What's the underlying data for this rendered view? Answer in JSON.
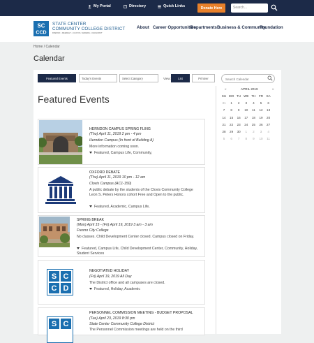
{
  "topbar": {
    "portal": "My Portal",
    "directory": "Directory",
    "quicklinks": "Quick Links",
    "donate": "Donate Here",
    "search_placeholder": "Search..."
  },
  "logo": {
    "line1": "STATE CENTER",
    "line2": "COMMUNITY COLLEGE DISTRICT",
    "line3": "FRESNO • REEDLEY • CLOVIS • MADERA • OAKHURST",
    "mark": "SC CCD"
  },
  "nav": [
    "About",
    "Career Opportunities",
    "Departments",
    "Business & Community",
    "Foundation"
  ],
  "breadcrumb": "Home / Calendar",
  "page_title": "Calendar",
  "toolbar": {
    "featured": "Featured Events",
    "today": "Today's Events",
    "category": "Select Category",
    "view_label": "View:",
    "list": "List",
    "print": "Printver",
    "search_placeholder": "Search Calendar"
  },
  "featured_heading": "Featured Events",
  "events": [
    {
      "title": "HERNDON CAMPUS SPRING FLING",
      "date": "(Thu) April 11, 2019 2 pm - 4 pm",
      "location": "Herndon Campus (In front of Building A)",
      "desc": "More information coming soon.",
      "tags": "Featured, Campus Life, Community,"
    },
    {
      "title": "OXFORD DEBATE",
      "date": "(Thu) April 11, 2019 10 pm - 12 am",
      "location": "Clovis Campus (AC1-150)",
      "desc": "A public debate by the students of the Clovis Community College Leon S. Peters Honors cohort Free and Open to the public.",
      "tags": "Featured, Academic, Campus Life,"
    },
    {
      "title": "SPRING BREAK",
      "date": "(Mon) April 15 - (Fri) April 19, 2019 3 am - 3 am",
      "location": "Fresno City College",
      "desc": "No classes. Child Development Center closed. Campus closed on Friday.",
      "tags": "Featured, Campus Life, Child Development Center, Community, Holiday, Student Services"
    },
    {
      "title": "NEGOTIATED HOLIDAY",
      "date": "(Fri) April 19, 2019 All Day",
      "location": "",
      "desc": "The District office and all campuses are closed.",
      "tags": "Featured, Holiday, Academic"
    },
    {
      "title": "PERSONNEL COMMISSION MEETING - BUDGET PROPOSAL",
      "date": "(Tue) April 23, 2019 8:30 pm",
      "location": "State Center Community College District",
      "desc": "The Personnel Commission meetings are held on the third",
      "tags": ""
    }
  ],
  "calendar": {
    "month": "APRIL 2019",
    "prev": "«",
    "next": "»",
    "days": [
      "SU",
      "MO",
      "TU",
      "WE",
      "TH",
      "FR",
      "SA"
    ],
    "weeks": [
      [
        "31",
        "1",
        "2",
        "3",
        "4",
        "5",
        "6"
      ],
      [
        "7",
        "8",
        "9",
        "10",
        "11",
        "12",
        "13"
      ],
      [
        "14",
        "15",
        "16",
        "17",
        "18",
        "19",
        "20"
      ],
      [
        "21",
        "22",
        "23",
        "24",
        "25",
        "26",
        "27"
      ],
      [
        "28",
        "29",
        "30",
        "1",
        "2",
        "3",
        "4"
      ],
      [
        "5",
        "6",
        "7",
        "8",
        "9",
        "10",
        "11"
      ]
    ],
    "muted": [
      [
        0,
        0
      ],
      [
        4,
        3
      ],
      [
        4,
        4
      ],
      [
        4,
        5
      ],
      [
        4,
        6
      ],
      [
        5,
        0
      ],
      [
        5,
        1
      ],
      [
        5,
        2
      ],
      [
        5,
        3
      ],
      [
        5,
        4
      ],
      [
        5,
        5
      ],
      [
        5,
        6
      ]
    ]
  },
  "colors": {
    "navy": "#1c2a48",
    "orange": "#e8802a",
    "logo_blue": "#1a6fb0",
    "page_bg": "#eef0f0"
  }
}
